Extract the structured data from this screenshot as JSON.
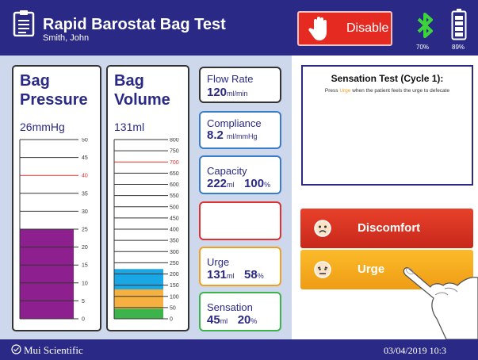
{
  "header": {
    "title": "Rapid Barostat Bag Test",
    "patient": "Smith, John",
    "disable_label": "Disable",
    "bluetooth_pct": "70%",
    "battery_pct": "89%",
    "bg_color": "#2a2a86"
  },
  "pressure": {
    "title_line1": "Bag",
    "title_line2": "Pressure",
    "value": "26mmHg",
    "ticks": [
      "50",
      "45",
      "40",
      "35",
      "30",
      "25",
      "20",
      "15",
      "10",
      "5",
      "0"
    ],
    "max": 50,
    "fill_value": 25,
    "threshold": 40,
    "fill_color": "#8e1f8e"
  },
  "volume": {
    "title_line1": "Bag",
    "title_line2": "Volume",
    "value": "131ml",
    "ticks": [
      "800",
      "750",
      "700",
      "650",
      "600",
      "550",
      "500",
      "450",
      "400",
      "350",
      "300",
      "250",
      "200",
      "150",
      "100",
      "50",
      "0"
    ],
    "max": 800,
    "threshold": 700,
    "segments": [
      {
        "from": 0,
        "to": 45,
        "color": "#3cb44b"
      },
      {
        "from": 45,
        "to": 131,
        "color": "#f6b040"
      },
      {
        "from": 131,
        "to": 222,
        "color": "#1aa7e6"
      }
    ]
  },
  "metrics": {
    "flow_rate": {
      "label": "Flow Rate",
      "value": "120",
      "unit": "ml/min"
    },
    "compliance": {
      "label": "Compliance",
      "value": "8.2",
      "unit": "ml/mmHg"
    },
    "capacity": {
      "label": "Capacity",
      "value": "222",
      "unit": "ml",
      "pct": "100",
      "pct_unit": "%"
    },
    "discomfort": {
      "label": ""
    },
    "urge": {
      "label": "Urge",
      "value": "131",
      "unit": "ml",
      "pct": "58",
      "pct_unit": "%"
    },
    "sensation": {
      "label": "Sensation",
      "value": "45",
      "unit": "ml",
      "pct": "20",
      "pct_unit": "%"
    }
  },
  "sensation_test": {
    "title": "Sensation Test (Cycle 1):",
    "instr_before": "Press ",
    "instr_highlight": "Urge",
    "instr_after": " when the patient feels the urge to defecate"
  },
  "buttons": {
    "discomfort_label": "Discomfort",
    "urge_label": "Urge"
  },
  "footer": {
    "brand": "Mui Scientific",
    "datetime": "03/04/2019 10:3"
  },
  "colors": {
    "navy": "#2a2a86",
    "threshold_red": "#e03030"
  }
}
